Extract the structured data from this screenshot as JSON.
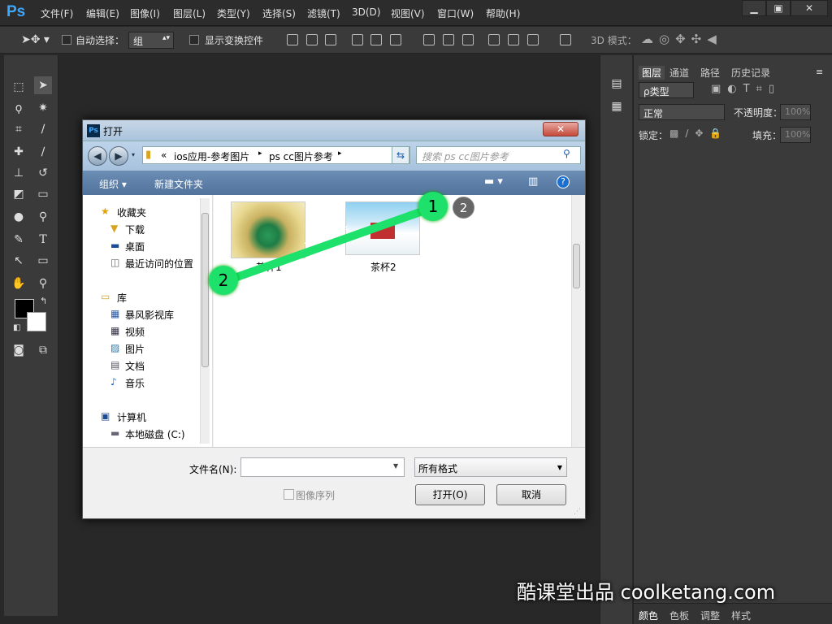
{
  "app": {
    "logo": "Ps"
  },
  "menu": [
    "文件(F)",
    "编辑(E)",
    "图像(I)",
    "图层(L)",
    "类型(Y)",
    "选择(S)",
    "滤镜(T)",
    "3D(D)",
    "视图(V)",
    "窗口(W)",
    "帮助(H)"
  ],
  "options": {
    "auto_select_label": "自动选择：",
    "auto_select_value": "组",
    "show_transform_label": "显示变换控件",
    "mode3d_label": "3D 模式："
  },
  "panel": {
    "tabs": [
      "图层",
      "通道",
      "路径",
      "历史记录"
    ],
    "kind_filter": "ρ类型",
    "blend_mode": "正常",
    "opacity_label": "不透明度：",
    "opacity_value": "100%",
    "lock_label": "锁定：",
    "fill_label": "填充：",
    "fill_value": "100%",
    "bottom_tabs": [
      "颜色",
      "色板",
      "调整",
      "样式"
    ]
  },
  "dialog": {
    "title": "打开",
    "path_prefix": "«",
    "path_parts": [
      "ios应用-参考图片",
      "ps cc图片参考"
    ],
    "search_placeholder": "搜索 ps cc图片参考",
    "toolbar": {
      "organize": "组织 ▾",
      "new_folder": "新建文件夹"
    },
    "nav": {
      "favorites": "收藏夹",
      "favorites_items": [
        "下载",
        "桌面",
        "最近访问的位置"
      ],
      "library": "库",
      "library_items": [
        "暴风影视库",
        "视频",
        "图片",
        "文档",
        "音乐"
      ],
      "computer": "计算机",
      "computer_items": [
        "本地磁盘 (C:)"
      ]
    },
    "files": [
      {
        "name": "茶杯1"
      },
      {
        "name": "茶杯2"
      }
    ],
    "filename_label": "文件名(N):",
    "filename_value": "",
    "filetype_value": "所有格式",
    "image_sequence_label": "图像序列",
    "open_button": "打开(O)",
    "cancel_button": "取消"
  },
  "annotations": {
    "step1": "1",
    "step2": "2",
    "badge": "2",
    "drag_arrows": "< < < <"
  },
  "watermark": "酷课堂出品 coolketang.com",
  "colors": {
    "ps_blue": "#3da8ff",
    "marker_green": "#1de16a",
    "badge_gray": "#666666"
  }
}
